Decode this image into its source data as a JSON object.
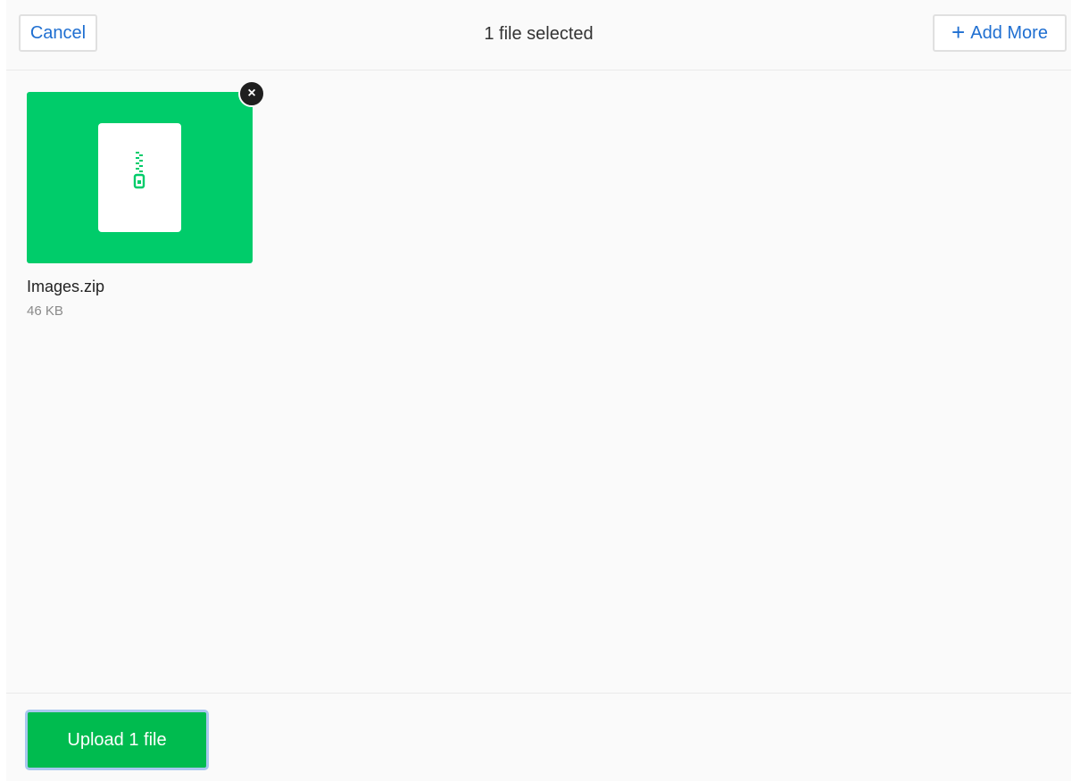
{
  "header": {
    "cancel_label": "Cancel",
    "title": "1 file selected",
    "add_more_icon": "+",
    "add_more_label": "Add More"
  },
  "files": [
    {
      "name": "Images.zip",
      "size": "46 KB",
      "icon": "zip-archive-icon",
      "thumb_color": "#00cc6a",
      "remove_icon": "×"
    }
  ],
  "footer": {
    "upload_label": "Upload 1 file",
    "upload_color": "#00bb4f"
  },
  "colors": {
    "accent": "#1f6fd1",
    "success": "#00cc6a"
  }
}
